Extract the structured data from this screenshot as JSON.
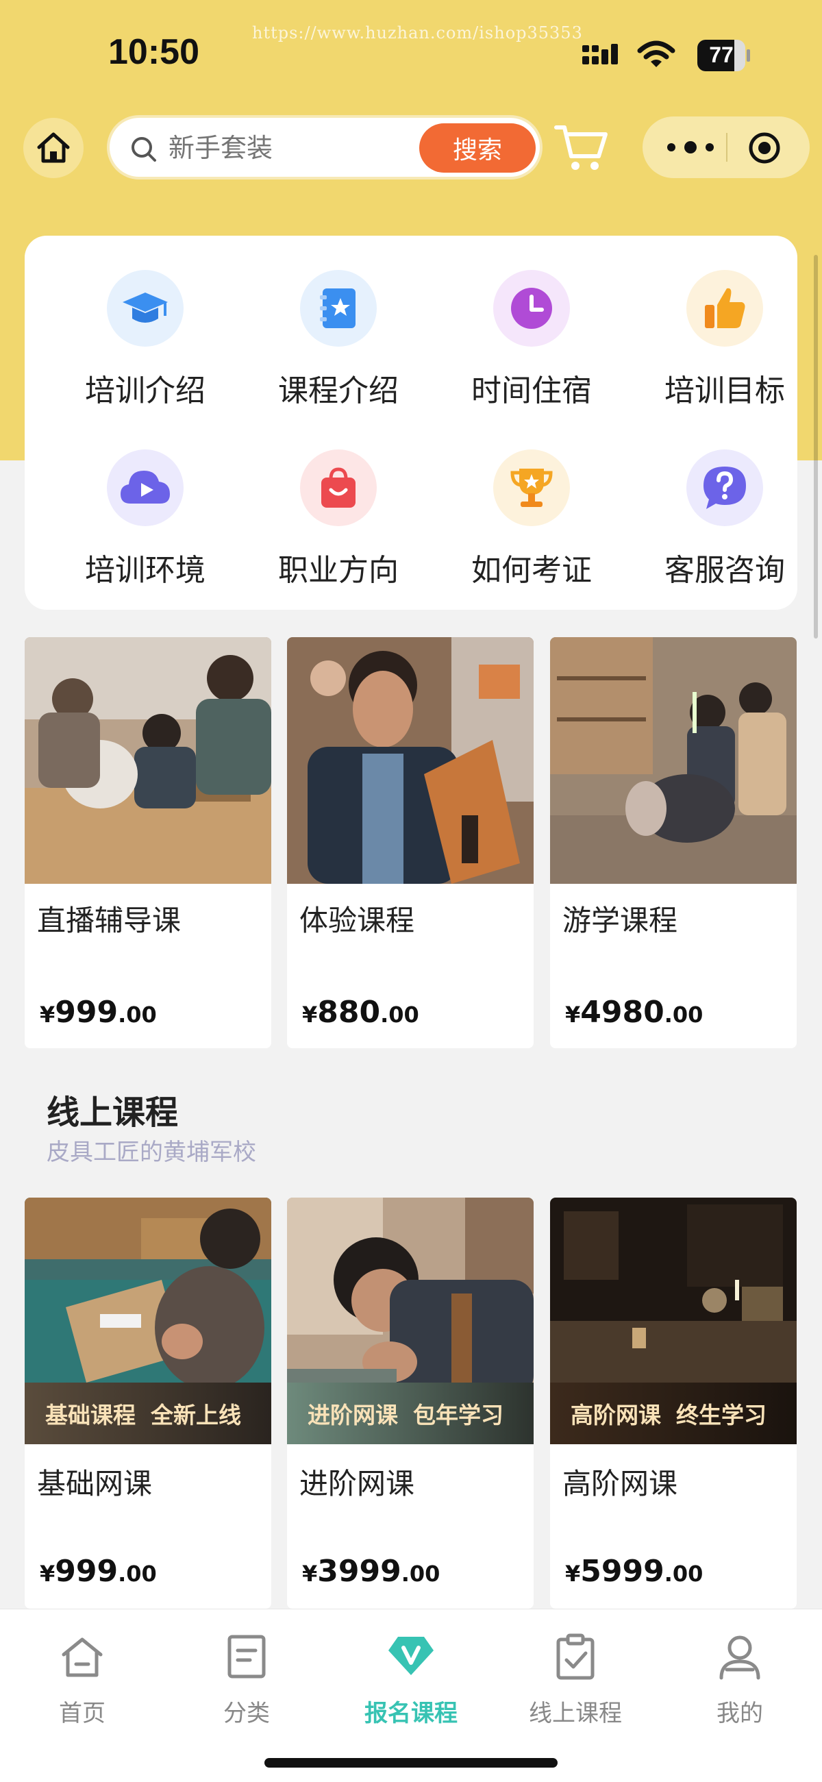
{
  "status_bar": {
    "time": "10:50",
    "battery": "77",
    "battery_level": 0.77,
    "watermark": "https://www.huzhan.com/ishop35353"
  },
  "header": {
    "search_placeholder": "新手套装",
    "search_button": "搜索"
  },
  "menu": [
    {
      "label": "培训介绍",
      "icon": "graduation-cap-icon",
      "color": "#3b8ff0",
      "bg": "#e6f1fd"
    },
    {
      "label": "课程介绍",
      "icon": "notebook-star-icon",
      "color": "#3b8ff0",
      "bg": "#e6f1fd"
    },
    {
      "label": "时间住宿",
      "icon": "clock-icon",
      "color": "#b04bd6",
      "bg": "#f5e6fb"
    },
    {
      "label": "培训目标",
      "icon": "thumbs-up-icon",
      "color": "#f5a623",
      "bg": "#fdf2dc"
    },
    {
      "label": "培训环境",
      "icon": "play-cloud-icon",
      "color": "#6c63e8",
      "bg": "#eceafd"
    },
    {
      "label": "职业方向",
      "icon": "shopping-bag-icon",
      "color": "#ec4a4f",
      "bg": "#fde6e6"
    },
    {
      "label": "如何考证",
      "icon": "trophy-icon",
      "color": "#f5a623",
      "bg": "#fdf2dc"
    },
    {
      "label": "客服咨询",
      "icon": "question-bubble-icon",
      "color": "#6c63e8",
      "bg": "#eceafd"
    }
  ],
  "featured_products": [
    {
      "title": "直播辅导课",
      "currency": "¥",
      "price_int": "999",
      "price_dec": ".00"
    },
    {
      "title": "体验课程",
      "currency": "¥",
      "price_int": "880",
      "price_dec": ".00"
    },
    {
      "title": "游学课程",
      "currency": "¥",
      "price_int": "4980",
      "price_dec": ".00"
    }
  ],
  "online_section": {
    "title": "线上课程",
    "subtitle": "皮具工匠的黄埔军校"
  },
  "online_products": [
    {
      "title": "基础网课",
      "banner_a": "基础课程",
      "banner_b": "全新上线",
      "currency": "¥",
      "price_int": "999",
      "price_dec": ".00"
    },
    {
      "title": "进阶网课",
      "banner_a": "进阶网课",
      "banner_b": "包年学习",
      "currency": "¥",
      "price_int": "3999",
      "price_dec": ".00"
    },
    {
      "title": "高阶网课",
      "banner_a": "高阶网课",
      "banner_b": "终生学习",
      "currency": "¥",
      "price_int": "5999",
      "price_dec": ".00"
    }
  ],
  "tabbar": [
    {
      "label": "首页",
      "icon": "home-icon"
    },
    {
      "label": "分类",
      "icon": "category-doc-icon"
    },
    {
      "label": "报名课程",
      "icon": "v-diamond-icon",
      "active": true
    },
    {
      "label": "线上课程",
      "icon": "checklist-icon"
    },
    {
      "label": "我的",
      "icon": "user-icon"
    }
  ],
  "colors": {
    "theme_yellow": "#f1d76e",
    "accent_orange": "#f26a34",
    "active_teal": "#37c3b3"
  }
}
